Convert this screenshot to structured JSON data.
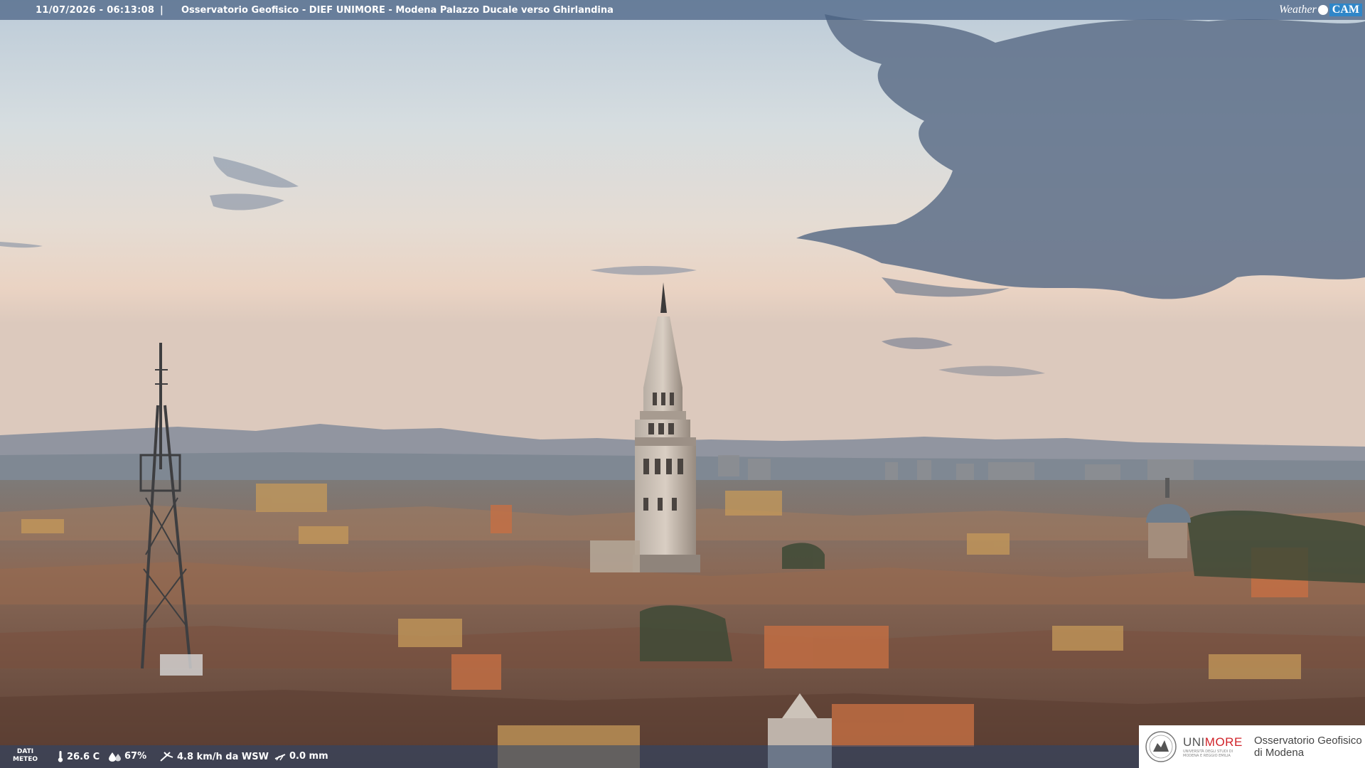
{
  "overlay": {
    "datetime": "11/07/2026 - 06:13:08",
    "separator": "|",
    "title": "Osservatorio Geofisico - DIEF UNIMORE - Modena Palazzo Ducale verso Ghirlandina",
    "brand_weather": "Weather",
    "brand_cam": "CAM"
  },
  "meteo": {
    "label_line1": "DATI",
    "label_line2": "METEO",
    "temperature": "26.6 C",
    "humidity": "67%",
    "wind": "4.8 km/h da WSW",
    "rain": "0.0 mm",
    "icons": [
      "thermometer-icon",
      "humidity-drop-icon",
      "wind-icon",
      "rain-icon"
    ]
  },
  "logo": {
    "unimore_prefix": "UNI",
    "unimore_suffix": "MORE",
    "university_line": "UNIVERSITÀ DEGLI STUDI DI MODENA E REGGIO EMILIA",
    "observatory_line1": "Osservatorio Geofisico",
    "observatory_line2": "di Modena"
  },
  "colors": {
    "sky_top": "#c9d6e0",
    "sky_horizon": "#e8cfbf",
    "cloud": "#5d6e88",
    "roofs": "#8a5e48",
    "overlay_bar": "#466082",
    "unimore_red": "#d0232a"
  }
}
